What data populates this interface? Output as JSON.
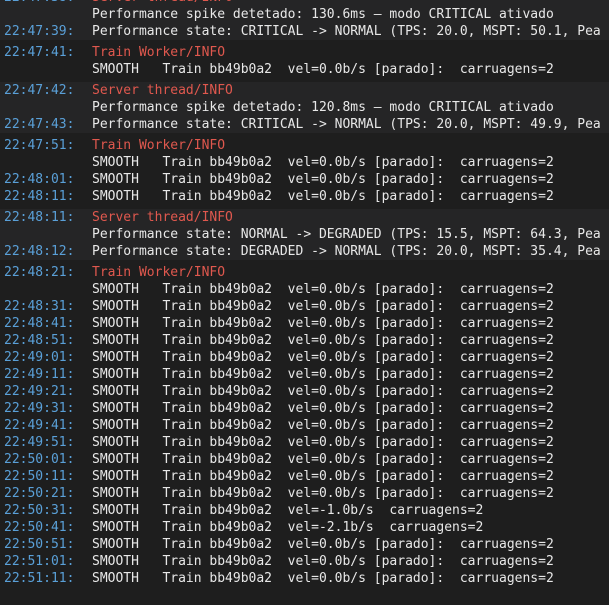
{
  "colors": {
    "background": "#1e1e1e",
    "alt_background": "#252526",
    "timestamp": "#5aa0d8",
    "source_header": "#e0584e",
    "message": "#e8e8e8"
  },
  "groups": [
    {
      "source": "Server thread/INFO",
      "alt": true,
      "lines": [
        {
          "time": "22:47:38:",
          "text": "Performance spike detetado: 130.6ms — modo CRITICAL ativado"
        },
        {
          "time": "22:47:39:",
          "text": "Performance state: CRITICAL -> NORMAL (TPS: 20.0, MSPT: 50.1, Pea"
        }
      ]
    },
    {
      "source": "Train Worker/INFO",
      "alt": false,
      "lines": [
        {
          "time": "22:47:41:",
          "text": "SMOOTH   Train bb49b0a2  vel=0.0b/s [parado]:  carruagens=2"
        }
      ]
    },
    {
      "source": "Server thread/INFO",
      "alt": true,
      "lines": [
        {
          "time": "22:47:42:",
          "text": "Performance spike detetado: 120.8ms — modo CRITICAL ativado"
        },
        {
          "time": "22:47:43:",
          "text": "Performance state: CRITICAL -> NORMAL (TPS: 20.0, MSPT: 49.9, Pea"
        }
      ]
    },
    {
      "source": "Train Worker/INFO",
      "alt": false,
      "lines": [
        {
          "time": "22:47:51:",
          "text": "SMOOTH   Train bb49b0a2  vel=0.0b/s [parado]:  carruagens=2"
        },
        {
          "time": "22:48:01:",
          "text": "SMOOTH   Train bb49b0a2  vel=0.0b/s [parado]:  carruagens=2"
        },
        {
          "time": "22:48:11:",
          "text": "SMOOTH   Train bb49b0a2  vel=0.0b/s [parado]:  carruagens=2"
        }
      ]
    },
    {
      "source": "Server thread/INFO",
      "alt": true,
      "lines": [
        {
          "time": "22:48:11:",
          "text": "Performance state: NORMAL -> DEGRADED (TPS: 15.5, MSPT: 64.3, Pea"
        },
        {
          "time": "22:48:12:",
          "text": "Performance state: DEGRADED -> NORMAL (TPS: 20.0, MSPT: 35.4, Pea"
        }
      ]
    },
    {
      "source": "Train Worker/INFO",
      "alt": false,
      "lines": [
        {
          "time": "22:48:21:",
          "text": "SMOOTH   Train bb49b0a2  vel=0.0b/s [parado]:  carruagens=2"
        },
        {
          "time": "22:48:31:",
          "text": "SMOOTH   Train bb49b0a2  vel=0.0b/s [parado]:  carruagens=2"
        },
        {
          "time": "22:48:41:",
          "text": "SMOOTH   Train bb49b0a2  vel=0.0b/s [parado]:  carruagens=2"
        },
        {
          "time": "22:48:51:",
          "text": "SMOOTH   Train bb49b0a2  vel=0.0b/s [parado]:  carruagens=2"
        },
        {
          "time": "22:49:01:",
          "text": "SMOOTH   Train bb49b0a2  vel=0.0b/s [parado]:  carruagens=2"
        },
        {
          "time": "22:49:11:",
          "text": "SMOOTH   Train bb49b0a2  vel=0.0b/s [parado]:  carruagens=2"
        },
        {
          "time": "22:49:21:",
          "text": "SMOOTH   Train bb49b0a2  vel=0.0b/s [parado]:  carruagens=2"
        },
        {
          "time": "22:49:31:",
          "text": "SMOOTH   Train bb49b0a2  vel=0.0b/s [parado]:  carruagens=2"
        },
        {
          "time": "22:49:41:",
          "text": "SMOOTH   Train bb49b0a2  vel=0.0b/s [parado]:  carruagens=2"
        },
        {
          "time": "22:49:51:",
          "text": "SMOOTH   Train bb49b0a2  vel=0.0b/s [parado]:  carruagens=2"
        },
        {
          "time": "22:50:01:",
          "text": "SMOOTH   Train bb49b0a2  vel=0.0b/s [parado]:  carruagens=2"
        },
        {
          "time": "22:50:11:",
          "text": "SMOOTH   Train bb49b0a2  vel=0.0b/s [parado]:  carruagens=2"
        },
        {
          "time": "22:50:21:",
          "text": "SMOOTH   Train bb49b0a2  vel=0.0b/s [parado]:  carruagens=2"
        },
        {
          "time": "22:50:31:",
          "text": "SMOOTH   Train bb49b0a2  vel=-1.0b/s  carruagens=2"
        },
        {
          "time": "22:50:41:",
          "text": "SMOOTH   Train bb49b0a2  vel=-2.1b/s  carruagens=2"
        },
        {
          "time": "22:50:51:",
          "text": "SMOOTH   Train bb49b0a2  vel=0.0b/s [parado]:  carruagens=2"
        },
        {
          "time": "22:51:01:",
          "text": "SMOOTH   Train bb49b0a2  vel=0.0b/s [parado]:  carruagens=2"
        },
        {
          "time": "22:51:11:",
          "text": "SMOOTH   Train bb49b0a2  vel=0.0b/s [parado]:  carruagens=2"
        }
      ]
    }
  ]
}
